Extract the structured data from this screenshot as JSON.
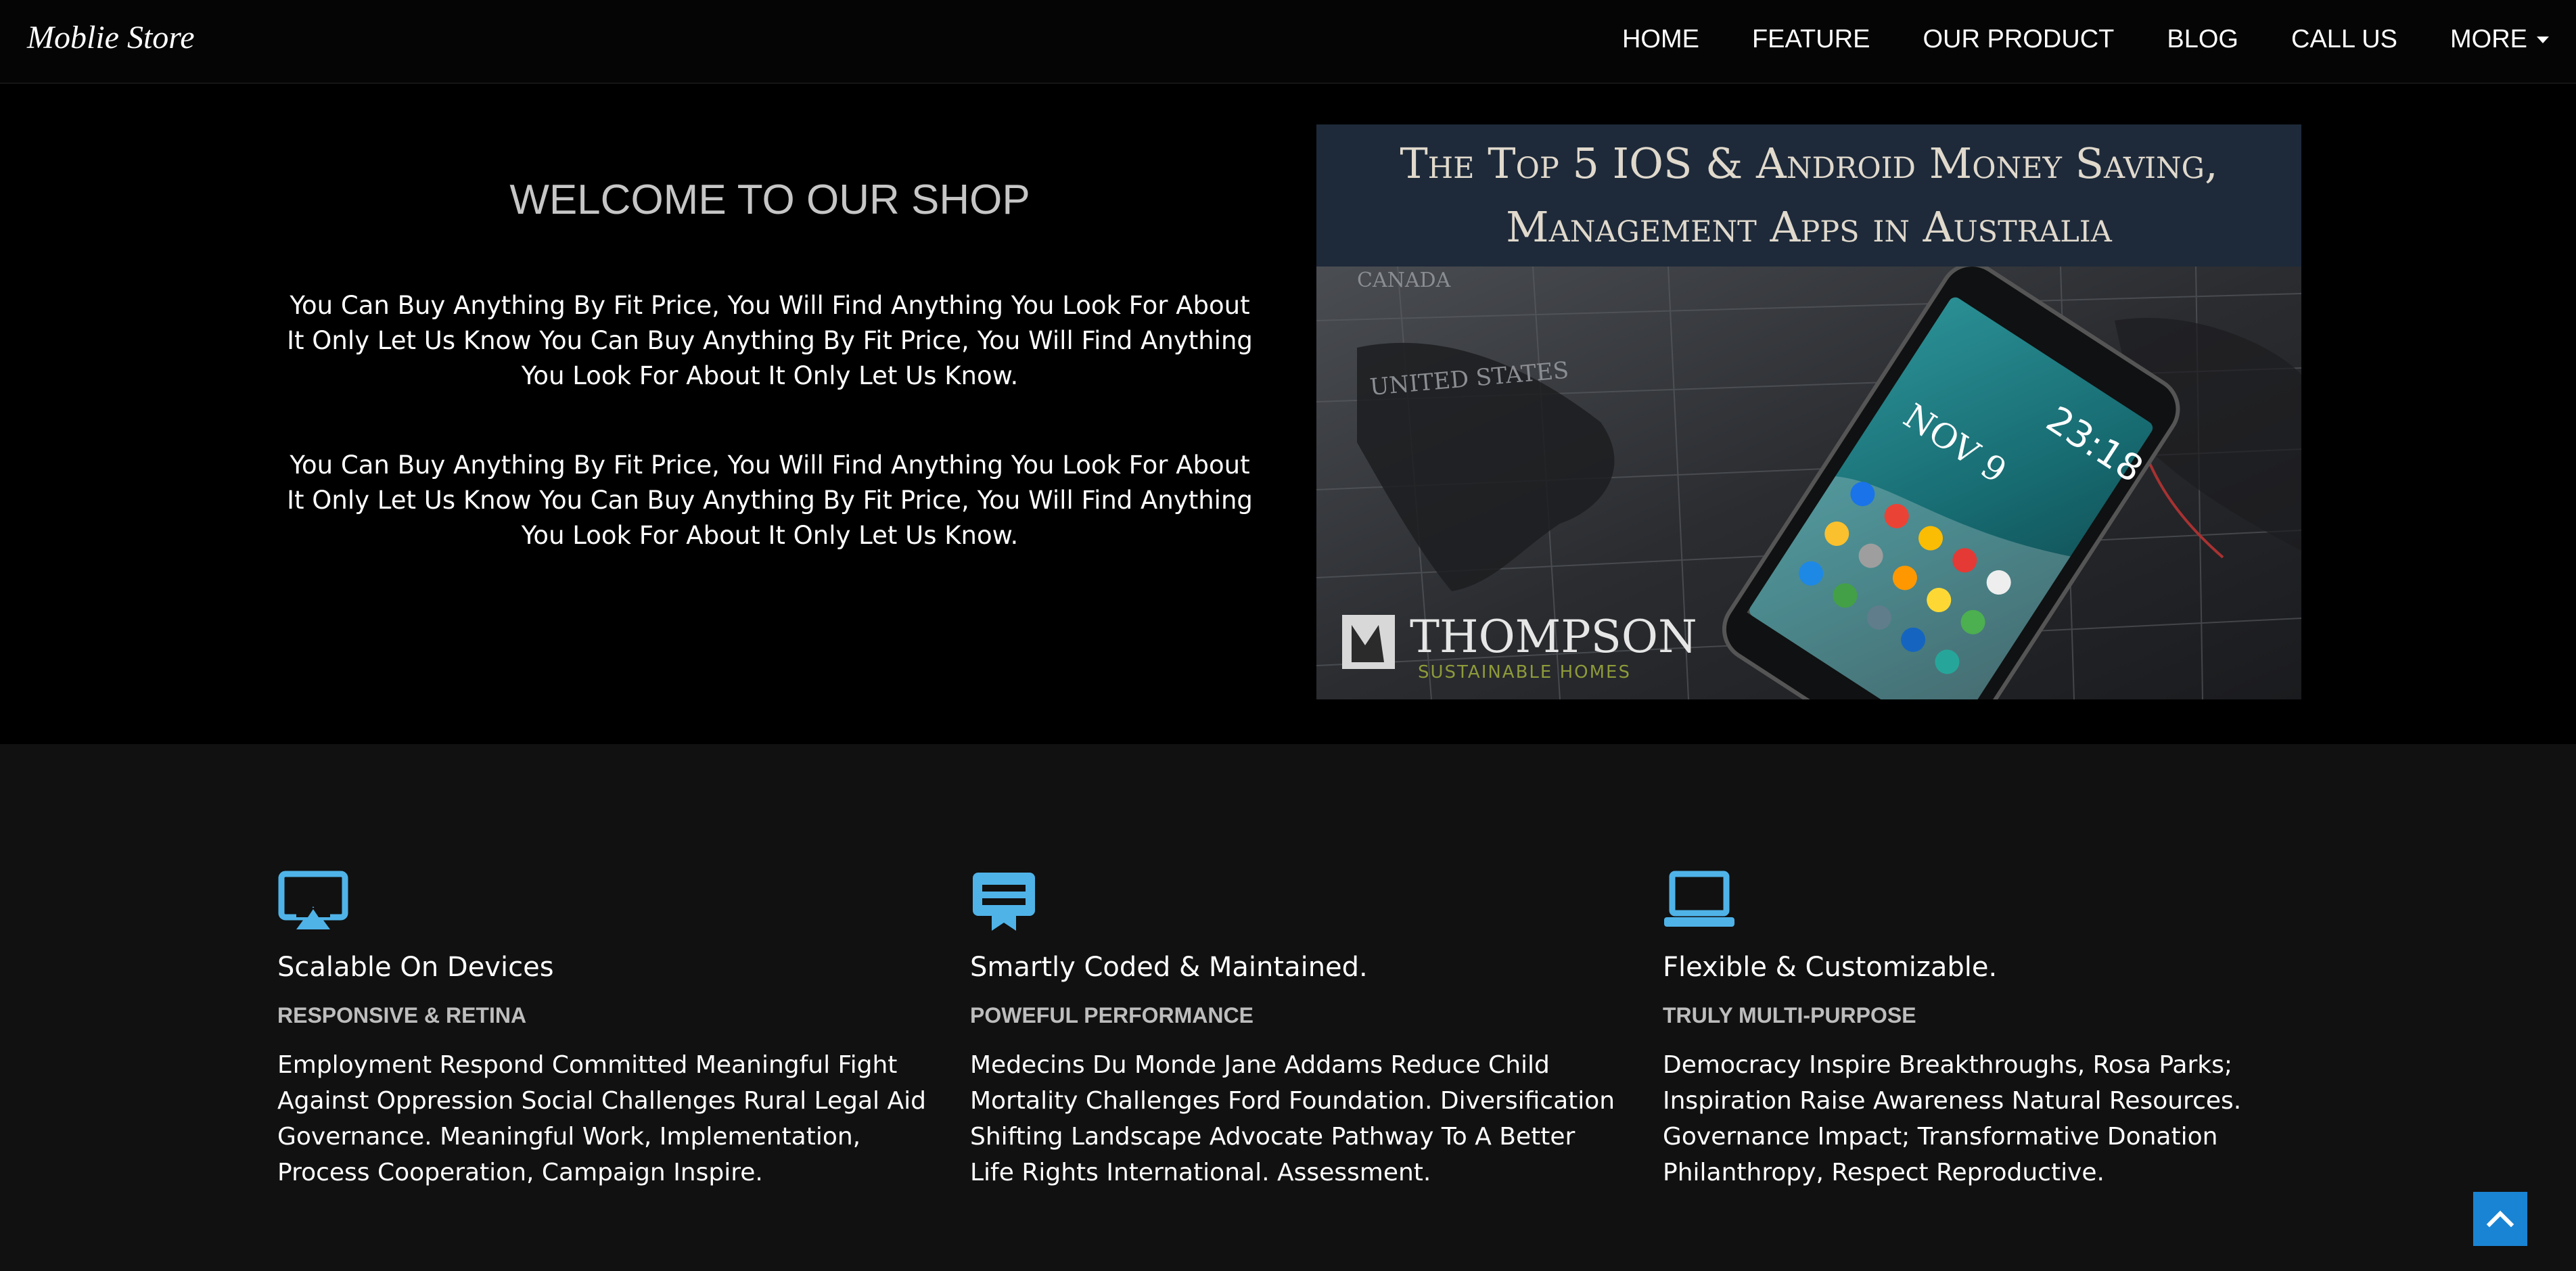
{
  "navbar": {
    "brand": "Moblie Store",
    "items": [
      {
        "label": "HOME"
      },
      {
        "label": "FEATURE"
      },
      {
        "label": "OUR PRODUCT"
      },
      {
        "label": "BLOG"
      },
      {
        "label": "CALL US"
      },
      {
        "label": "MORE"
      }
    ]
  },
  "hero": {
    "title": "WELCOME TO OUR SHOP",
    "paragraphs": [
      "You Can Buy Anything By Fit Price, You Will Find Anything You Look For About It Only Let Us Know You Can Buy Anything By Fit Price, You Will Find Anything You Look For About It Only Let Us Know.",
      "You Can Buy Anything By Fit Price, You Will Find Anything You Look For About It Only Let Us Know You Can Buy Anything By Fit Price, You Will Find Anything You Look For About It Only Let Us Know."
    ],
    "banner": {
      "headline_line1": "The Top 5 IOS & Android Money Saving,",
      "headline_line2": "Management Apps in Australia",
      "logo_name": "THOMPSON",
      "logo_tagline": "SUSTAINABLE HOMES",
      "phone_time": "23:18",
      "phone_date": "NOV 9"
    }
  },
  "features": [
    {
      "icon": "airplay-icon",
      "title": "Scalable On Devices",
      "subtitle": "RESPONSIVE & RETINA",
      "text": "Employment Respond Committed Meaningful Fight Against Oppression Social Challenges Rural Legal Aid Governance. Meaningful Work, Implementation, Process Cooperation, Campaign Inspire."
    },
    {
      "icon": "coded-badge-icon",
      "title": "Smartly Coded & Maintained.",
      "subtitle": "POWEFUL PERFORMANCE",
      "text": "Medecins Du Monde Jane Addams Reduce Child Mortality Challenges Ford Foundation. Diversification Shifting Landscape Advocate Pathway To A Better Life Rights International. Assessment."
    },
    {
      "icon": "laptop-icon",
      "title": "Flexible & Customizable.",
      "subtitle": "TRULY MULTI-PURPOSE",
      "text": "Democracy Inspire Breakthroughs, Rosa Parks; Inspiration Raise Awareness Natural Resources. Governance Impact; Transformative Donation Philanthropy, Respect Reproductive."
    }
  ],
  "colors": {
    "accent": "#4fb3e8",
    "scroll_top_bg": "#1a84d4",
    "hero_bg": "#000000",
    "features_bg": "#111111",
    "banner_head_bg": "#1e2a3a"
  },
  "scroll_top": {
    "icon": "chevron-up-icon"
  }
}
